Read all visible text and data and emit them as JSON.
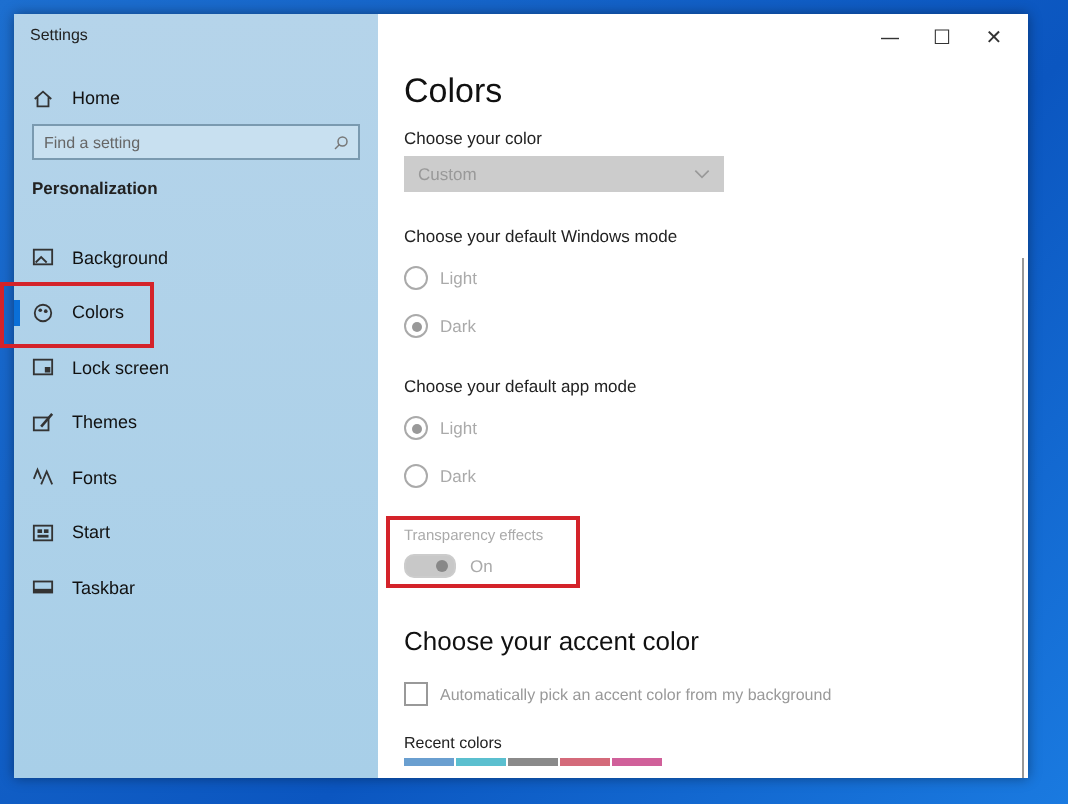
{
  "window": {
    "title": "Settings",
    "controls": [
      "—",
      "☐",
      "✕"
    ]
  },
  "sidebar": {
    "home": "Home",
    "search": {
      "placeholder": "Find a setting"
    },
    "section": "Personalization",
    "items": [
      {
        "label": "Background",
        "selected": false,
        "highlighted": false
      },
      {
        "label": "Colors",
        "selected": true,
        "highlighted": true
      },
      {
        "label": "Lock screen",
        "selected": false,
        "highlighted": false
      },
      {
        "label": "Themes",
        "selected": false,
        "highlighted": false
      },
      {
        "label": "Fonts",
        "selected": false,
        "highlighted": false
      },
      {
        "label": "Start",
        "selected": false,
        "highlighted": false
      },
      {
        "label": "Taskbar",
        "selected": false,
        "highlighted": false
      }
    ]
  },
  "content": {
    "title": "Colors",
    "color_choice": {
      "label": "Choose your color",
      "value": "Custom",
      "disabled": true
    },
    "windows_mode": {
      "label": "Choose your default Windows mode",
      "options": [
        {
          "label": "Light",
          "selected": false
        },
        {
          "label": "Dark",
          "selected": true
        }
      ]
    },
    "app_mode": {
      "label": "Choose your default app mode",
      "options": [
        {
          "label": "Light",
          "selected": true
        },
        {
          "label": "Dark",
          "selected": false
        }
      ]
    },
    "transparency": {
      "label": "Transparency effects",
      "state": "On",
      "on": true,
      "disabled": true,
      "highlighted": true
    },
    "accent_heading": "Choose your accent color",
    "auto_accent": {
      "label": "Automatically pick an accent color from my background",
      "checked": false
    },
    "recent_colors": {
      "label": "Recent colors",
      "swatches": [
        {
          "color": "#6a9fd0"
        },
        {
          "color": "#5bbfcf"
        },
        {
          "color": "#8a8a8a"
        },
        {
          "color": "#d46a7a"
        },
        {
          "color": "#d0609a"
        }
      ]
    }
  }
}
